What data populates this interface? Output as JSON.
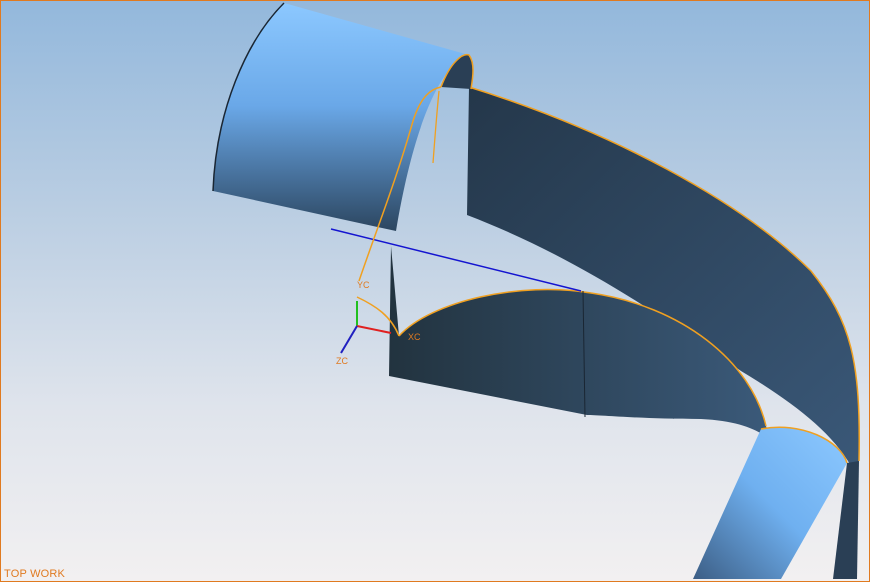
{
  "viewport": {
    "view_label": "TOP WORK",
    "border_color": "#e07a20"
  },
  "triad": {
    "xc_label": "XC",
    "yc_label": "YC",
    "zc_label": "ZC",
    "x_color": "#e02020",
    "y_color": "#20c020",
    "z_color": "#2020c0"
  },
  "colors": {
    "surface_dark": "#2a3f55",
    "surface_light": "#8cc8ff",
    "edge_highlight": "#f0a020"
  }
}
